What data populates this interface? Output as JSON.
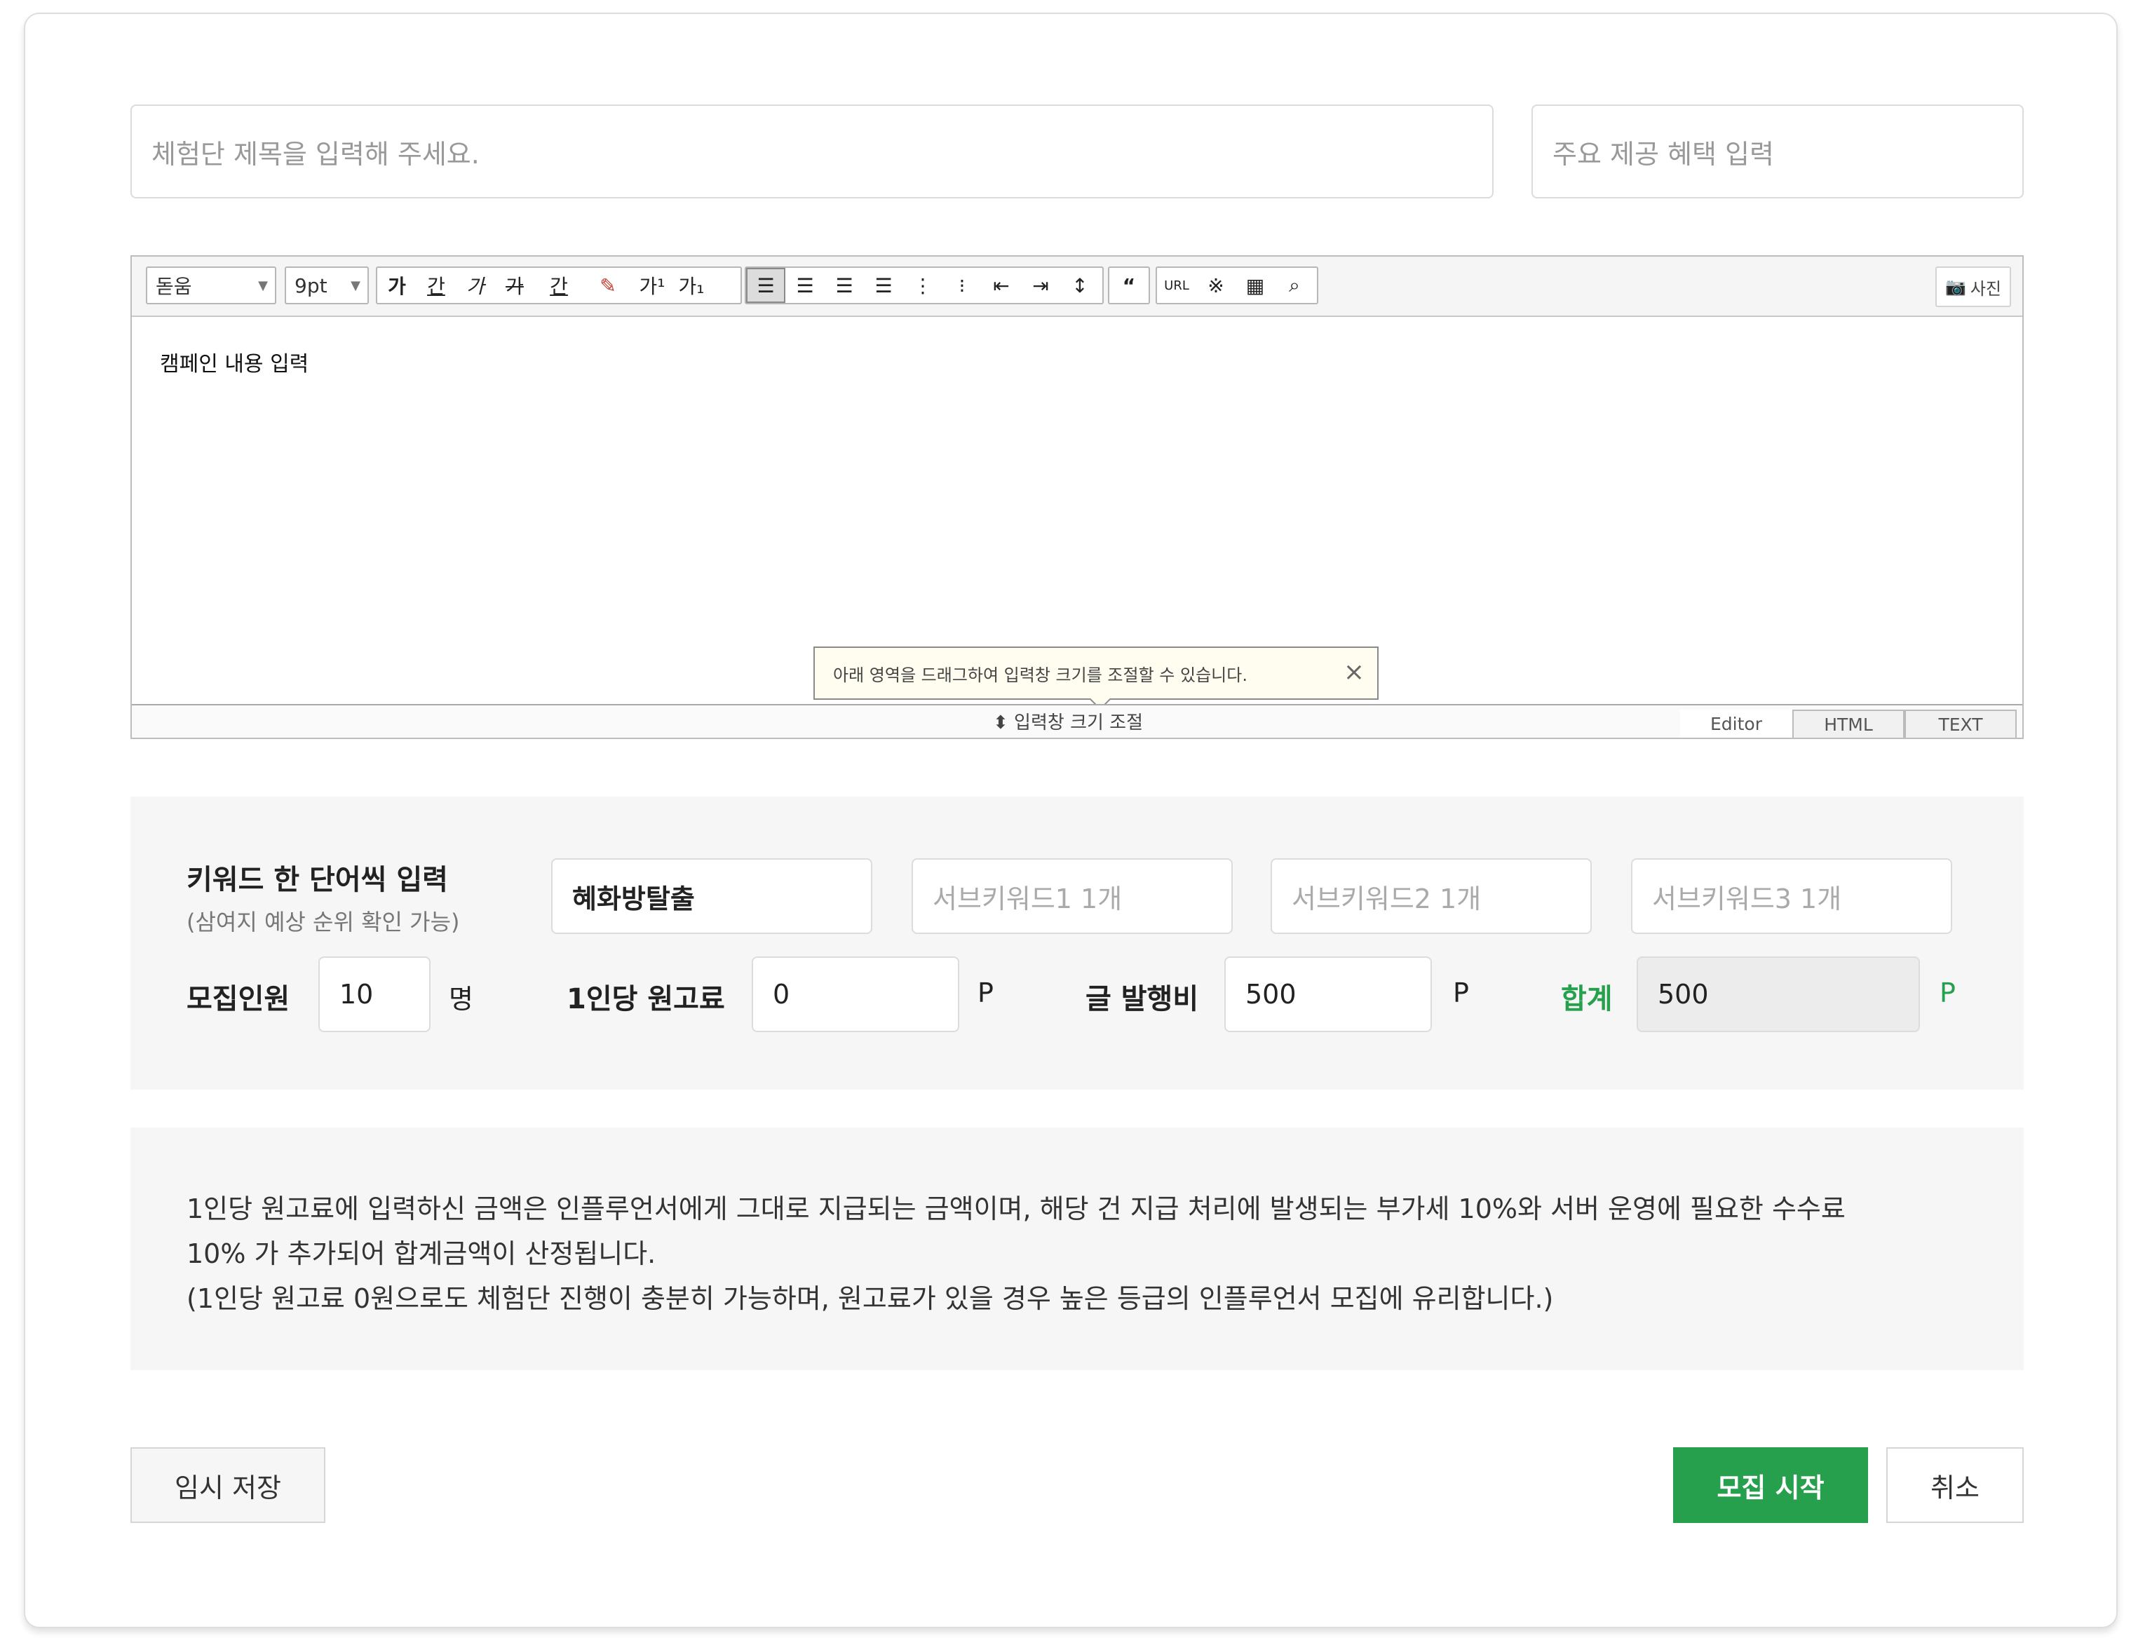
{
  "form": {
    "title_placeholder": "체험단 제목을 입력해 주세요.",
    "benefit_placeholder": "주요 제공 혜택 입력"
  },
  "editor": {
    "font_family": "돋움",
    "font_size": "9pt",
    "format_buttons": [
      "가",
      "간",
      "가",
      "가",
      "간"
    ],
    "superscript_label": "가¹",
    "subscript_label": "가₁",
    "photo_button": "사진",
    "body_text": "캠페인 내용 입력",
    "tooltip_text": "아래 영역을 드래그하여 입력창 크기를 조절할 수 있습니다.",
    "resize_label": "⬍ 입력창 크기 조절",
    "modes": [
      "Editor",
      "HTML",
      "TEXT"
    ]
  },
  "keywords": {
    "label": "키워드 한 단어씩 입력",
    "sublabel": "(삼여지 예상 순위 확인 가능)",
    "main_value": "혜화방탈출",
    "sub1_placeholder": "서브키워드1 1개",
    "sub2_placeholder": "서브키워드2 1개",
    "sub3_placeholder": "서브키워드3 1개"
  },
  "recruit": {
    "label": "모집인원",
    "value": "10",
    "unit": "명"
  },
  "fee": {
    "label": "1인당 원고료",
    "value": "0",
    "unit": "P"
  },
  "publish": {
    "label": "글 발행비",
    "value": "500",
    "unit": "P"
  },
  "total": {
    "label": "합계",
    "value": "500",
    "unit": "P"
  },
  "notice": {
    "line1": "1인당 원고료에 입력하신 금액은 인플루언서에게 그대로 지급되는 금액이며, 해당 건 지급 처리에 발생되는 부가세 10%와 서버 운영에 필요한 수수료",
    "line2": "10% 가 추가되어 합계금액이 산정됩니다.",
    "line3": "(1인당 원고료 0원으로도 체험단 진행이 충분히 가능하며, 원고료가 있을 경우 높은 등급의 인플루언서 모집에 유리합니다.)"
  },
  "buttons": {
    "temp_save": "임시 저장",
    "start": "모집 시작",
    "cancel": "취소"
  },
  "colors": {
    "accent": "#27a04e",
    "panel_bg": "#f6f6f6"
  }
}
